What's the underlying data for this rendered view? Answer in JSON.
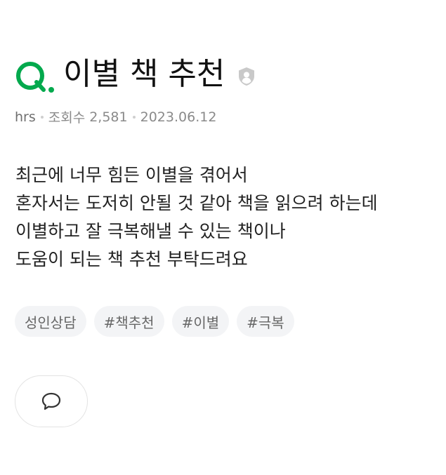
{
  "question": {
    "marker": "Q.",
    "title": "이별 책 추천",
    "privacy_icon": "profile-shield-icon"
  },
  "meta": {
    "author": "hrs",
    "views_label": "조회수",
    "views": "2,581",
    "date": "2023.06.12"
  },
  "body": {
    "lines": [
      "최근에 너무 힘든 이별을 겪어서",
      "혼자서는 도저히 안될 것 같아 책을 읽으려 하는데",
      "이별하고 잘 극복해낼 수 있는 책이나",
      "도움이 되는 책 추천 부탁드려요"
    ]
  },
  "tags": [
    "성인상담",
    "#책추천",
    "#이별",
    "#극복"
  ],
  "actions": {
    "comment_icon": "speech-bubble-icon"
  },
  "colors": {
    "brand_green": "#03A94D",
    "meta_gray": "#8A8A8A",
    "tag_bg": "#F3F4F6"
  }
}
